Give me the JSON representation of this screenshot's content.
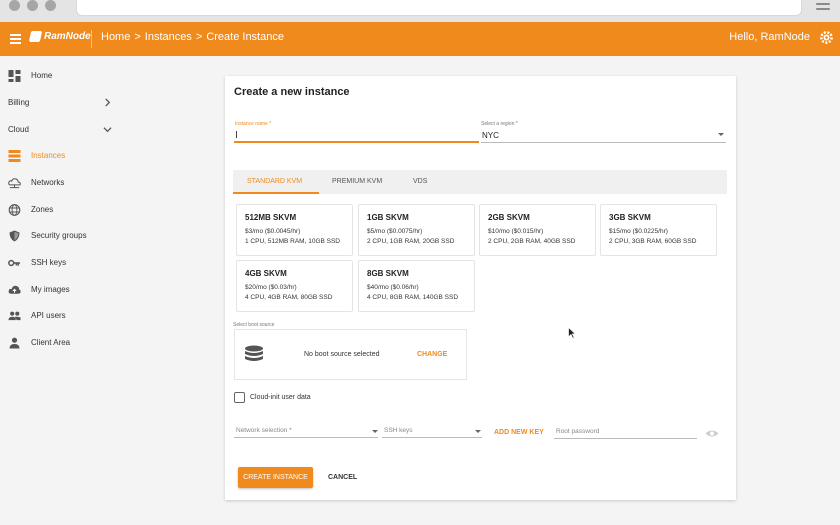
{
  "header": {
    "logo_text": "RamNode",
    "breadcrumb": [
      "Home",
      "Instances",
      "Create Instance"
    ],
    "breadcrumb_separator": ">",
    "greeting": "Hello, RamNode",
    "accent_color": "#f08a1d"
  },
  "sidebar": {
    "items": [
      {
        "label": "Home",
        "icon": "dashboard-icon"
      },
      {
        "label": "Billing",
        "icon": "chevron-right-icon"
      },
      {
        "label": "Cloud",
        "icon": "chevron-down-icon"
      },
      {
        "label": "Instances",
        "icon": "list-icon",
        "active": true
      },
      {
        "label": "Networks",
        "icon": "cloud-network-icon"
      },
      {
        "label": "Zones",
        "icon": "globe-icon"
      },
      {
        "label": "Security groups",
        "icon": "shield-icon"
      },
      {
        "label": "SSH keys",
        "icon": "key-icon"
      },
      {
        "label": "My images",
        "icon": "cloud-upload-icon"
      },
      {
        "label": "API users",
        "icon": "users-icon"
      },
      {
        "label": "Client Area",
        "icon": "person-icon"
      }
    ]
  },
  "form": {
    "title": "Create a new instance",
    "instance_name": {
      "label": "Instance name *",
      "value": ""
    },
    "region": {
      "label": "Select a region *",
      "value": "NYC"
    },
    "tabs": [
      {
        "label": "STANDARD KVM",
        "active": true
      },
      {
        "label": "PREMIUM KVM",
        "active": false
      },
      {
        "label": "VDS",
        "active": false
      }
    ],
    "plans": [
      {
        "name": "512MB SKVM",
        "price": "$3/mo ($0.0045/hr)",
        "spec": "1 CPU, 512MB RAM, 10GB SSD"
      },
      {
        "name": "1GB SKVM",
        "price": "$5/mo ($0.0075/hr)",
        "spec": "2 CPU, 1GB RAM, 20GB SSD"
      },
      {
        "name": "2GB SKVM",
        "price": "$10/mo ($0.015/hr)",
        "spec": "2 CPU, 2GB RAM, 40GB SSD"
      },
      {
        "name": "3GB SKVM",
        "price": "$15/mo ($0.0225/hr)",
        "spec": "2 CPU, 3GB RAM, 60GB SSD"
      },
      {
        "name": "4GB SKVM",
        "price": "$20/mo ($0.03/hr)",
        "spec": "4 CPU, 4GB RAM, 80GB SSD"
      },
      {
        "name": "8GB SKVM",
        "price": "$40/mo ($0.06/hr)",
        "spec": "4 CPU, 8GB RAM, 140GB SSD"
      }
    ],
    "boot_source": {
      "label": "Select boot source",
      "status": "No boot source selected",
      "change_label": "CHANGE"
    },
    "cloud_init": {
      "label": "Cloud-init user data",
      "checked": false
    },
    "network": {
      "placeholder": "Network selection *"
    },
    "ssh_keys": {
      "placeholder": "SSH keys"
    },
    "add_key_label": "ADD NEW KEY",
    "root_password": {
      "placeholder": "Root password"
    },
    "create_label": "CREATE INSTANCE",
    "cancel_label": "CANCEL"
  }
}
